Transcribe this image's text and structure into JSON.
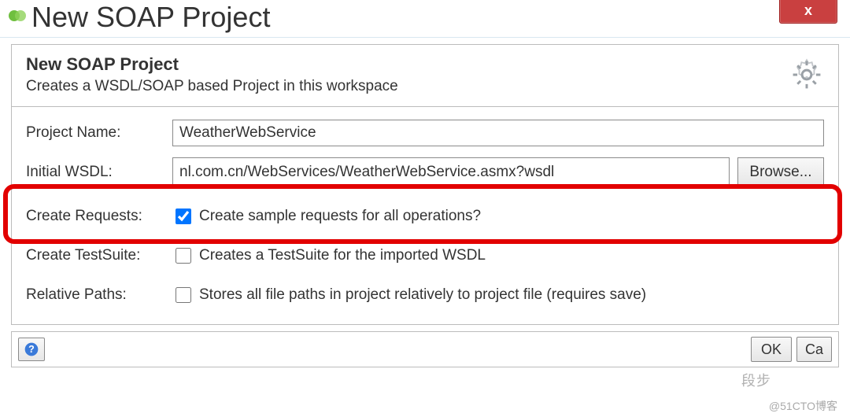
{
  "window": {
    "title": "New SOAP Project",
    "close_symbol": "x"
  },
  "header": {
    "title": "New SOAP Project",
    "description": "Creates a WSDL/SOAP based Project in this workspace"
  },
  "form": {
    "project_name_label": "Project Name:",
    "project_name_value": "WeatherWebService",
    "initial_wsdl_label": "Initial WSDL:",
    "initial_wsdl_value": "nl.com.cn/WebServices/WeatherWebService.asmx?wsdl",
    "browse_label": "Browse...",
    "create_requests_label": "Create Requests:",
    "create_requests_text": "Create sample requests for all operations?",
    "create_requests_checked": true,
    "create_testsuite_label": "Create TestSuite:",
    "create_testsuite_text": "Creates a TestSuite for the imported WSDL",
    "create_testsuite_checked": false,
    "relative_paths_label": "Relative Paths:",
    "relative_paths_text": "Stores all file paths in project relatively to project file (requires save)",
    "relative_paths_checked": false
  },
  "buttons": {
    "ok": "OK",
    "cancel": "Ca"
  },
  "watermark": "@51CTO博客",
  "watermark2": "段步"
}
